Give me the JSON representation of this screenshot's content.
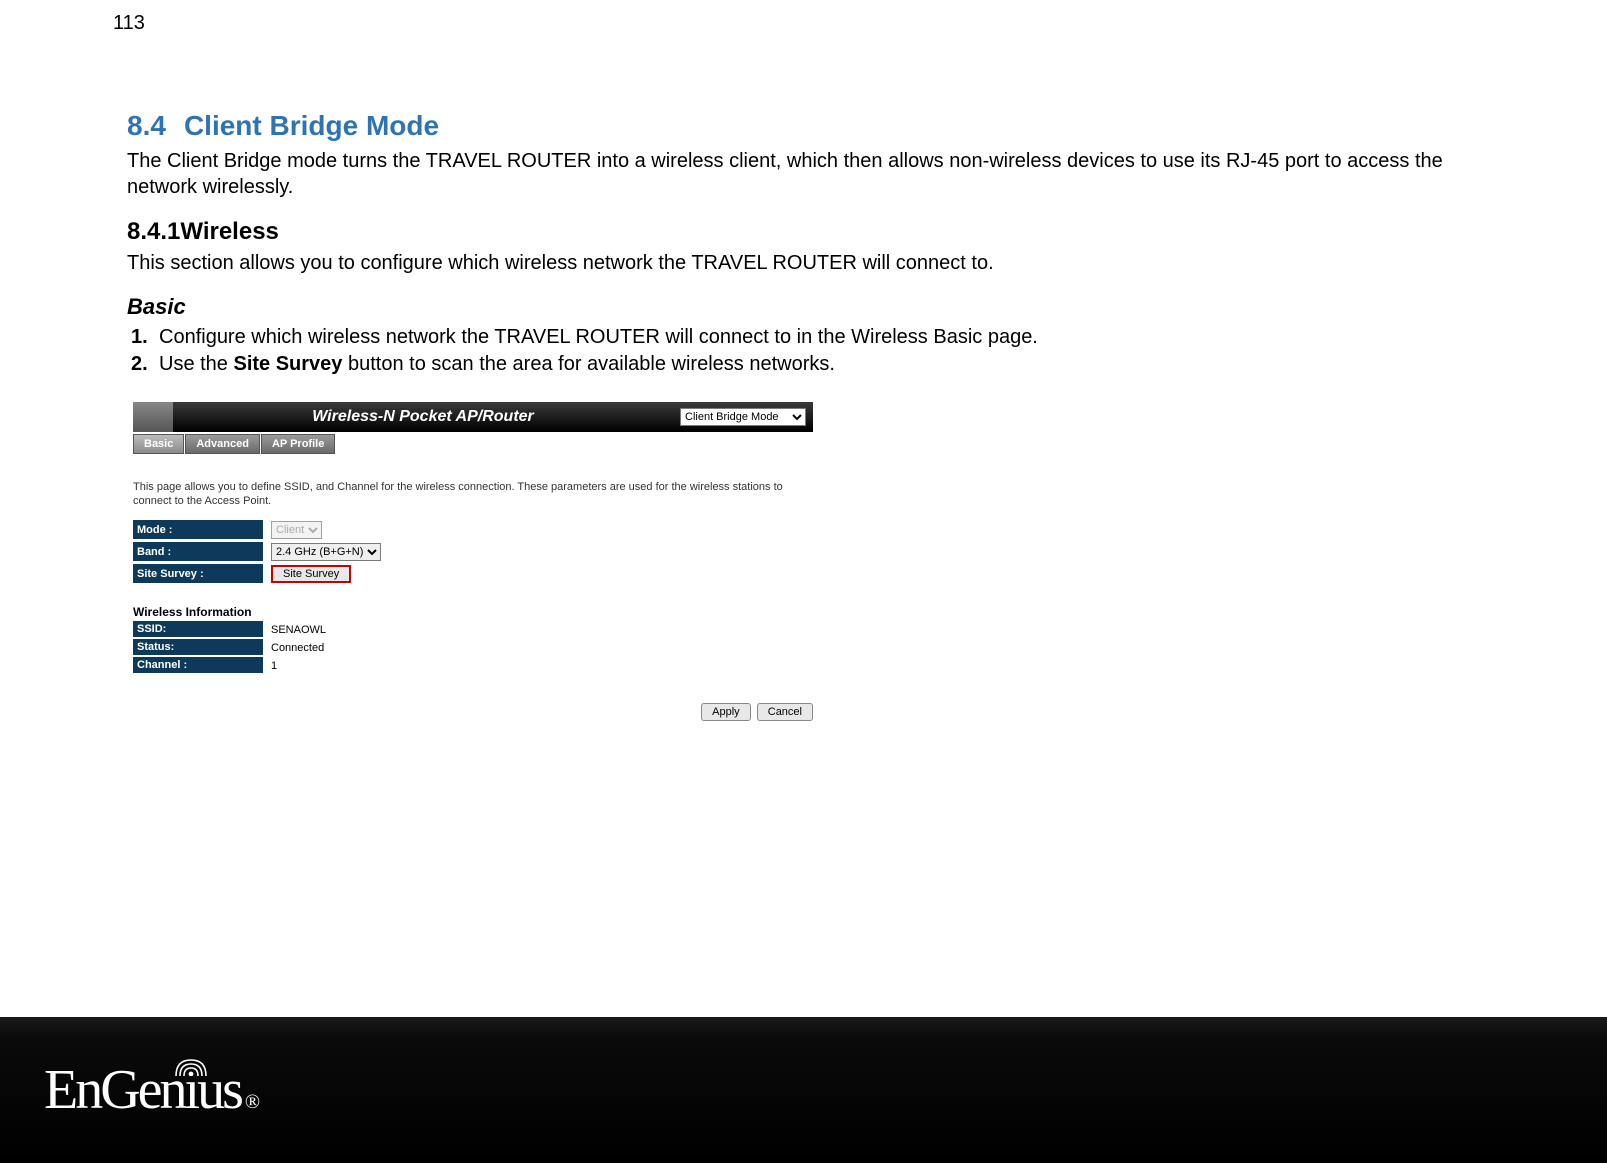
{
  "page_number": "113",
  "section": {
    "number": "8.4",
    "title": "Client Bridge Mode",
    "intro": "The Client Bridge mode turns the TRAVEL ROUTER into a wireless client, which then allows non-wireless devices to use its RJ-45 port to access the network wirelessly."
  },
  "subsection": {
    "number_title": "8.4.1Wireless",
    "intro": "This section allows you to configure which wireless network the TRAVEL ROUTER will connect to."
  },
  "basic": {
    "heading": "Basic",
    "items": [
      {
        "num": "1.",
        "text_pre": "Configure which wireless network the TRAVEL ROUTER will connect to in the Wireless Basic page."
      },
      {
        "num": "2.",
        "text_pre": "Use the ",
        "bold": "Site Survey",
        "text_post": " button to scan the area for available wireless networks."
      }
    ]
  },
  "router_ui": {
    "header_title": "Wireless-N Pocket AP/Router",
    "mode_select": "Client Bridge Mode",
    "tabs": [
      "Basic",
      "Advanced",
      "AP Profile"
    ],
    "description": "This page allows you to define SSID, and Channel for the wireless connection. These parameters are used for the wireless stations to connect to the Access Point.",
    "form": {
      "mode_label": "Mode :",
      "mode_value": "Client",
      "band_label": "Band :",
      "band_value": "2.4 GHz (B+G+N)",
      "survey_label": "Site Survey :",
      "survey_button": "Site Survey"
    },
    "info_heading": "Wireless Information",
    "info": {
      "ssid_label": "SSID:",
      "ssid_value": "SENAOWL",
      "status_label": "Status:",
      "status_value": "Connected",
      "channel_label": "Channel :",
      "channel_value": "1"
    },
    "buttons": {
      "apply": "Apply",
      "cancel": "Cancel"
    }
  },
  "footer": {
    "brand": "EnGenius",
    "registered": "®"
  }
}
